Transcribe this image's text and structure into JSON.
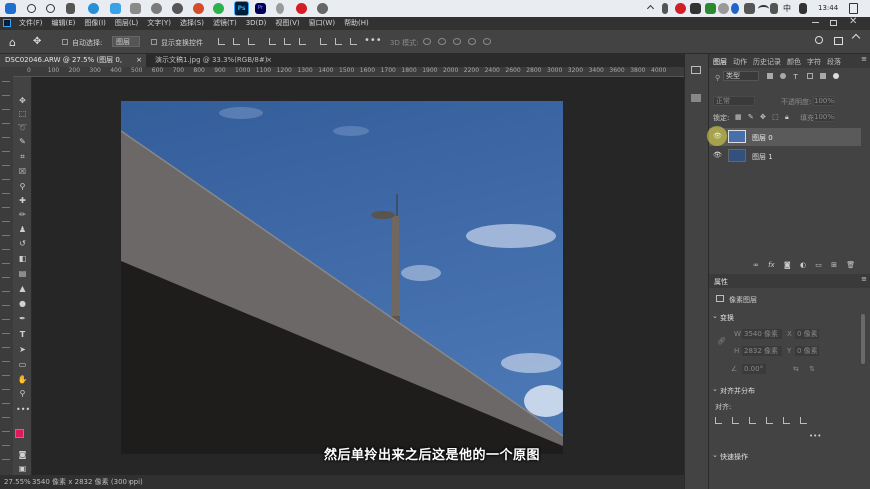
{
  "taskbar": {
    "time": "13:44",
    "lang": "中",
    "ps_badge": "Ps",
    "pr_badge": "Pr"
  },
  "menu": [
    "文件(F)",
    "编辑(E)",
    "图像(I)",
    "图层(L)",
    "文字(Y)",
    "选择(S)",
    "滤镜(T)",
    "3D(D)",
    "视图(V)",
    "窗口(W)",
    "帮助(H)"
  ],
  "options": {
    "auto_select": "自动选择:",
    "layer_select": "图层",
    "show_transform": "显示变换控件",
    "mode_3d": "3D 模式:"
  },
  "tabs": [
    {
      "label": "DSC02046.ARW @ 27.5% (图层 0, RGB/8*) *",
      "active": true
    },
    {
      "label": "演示文稿1.jpg @ 33.3%(RGB/8#) *",
      "active": false
    }
  ],
  "ruler_ticks": [
    "0",
    "100",
    "200",
    "300",
    "400",
    "500",
    "600",
    "700",
    "800",
    "900",
    "1000",
    "1100",
    "1200",
    "1300",
    "1400",
    "1500",
    "1600",
    "1700",
    "1800",
    "1900",
    "2000",
    "2200",
    "2400",
    "2600",
    "2800",
    "3000",
    "3200",
    "3400",
    "3600",
    "3800",
    "4000",
    "4200"
  ],
  "status": {
    "zoom": "27.55%",
    "size": "3540 像素 x 2832 像素 (300 ppi)"
  },
  "subtitle": "然后单拎出来之后这是他的一个原图",
  "panel": {
    "tabs": [
      "图层",
      "动作",
      "历史记录",
      "颜色",
      "字符",
      "段落"
    ],
    "kind": "类型",
    "blend": "正常",
    "opacity_label": "不透明度:",
    "opacity_value": "100%",
    "lock_label": "锁定:",
    "fill_label": "填充:",
    "fill_value": "100%",
    "layers": [
      {
        "name": "图层 0",
        "selected": true
      },
      {
        "name": "图层 1",
        "selected": false
      }
    ],
    "props_title": "属性",
    "pixel_layer": "像素图层",
    "transform": "变换",
    "w_label": "W",
    "w_value": "3540 像素",
    "x_label": "X",
    "x_value": "0 像素",
    "h_label": "H",
    "h_value": "2832 像素",
    "y_label": "Y",
    "y_value": "0 像素",
    "angle": "0.00°",
    "align_title": "对齐并分布",
    "align_label": "对齐:",
    "quick_actions": "快速操作"
  },
  "colors": {
    "foreground": "#e0195a",
    "background": "#ffffff",
    "sky": "#3f68a4"
  }
}
